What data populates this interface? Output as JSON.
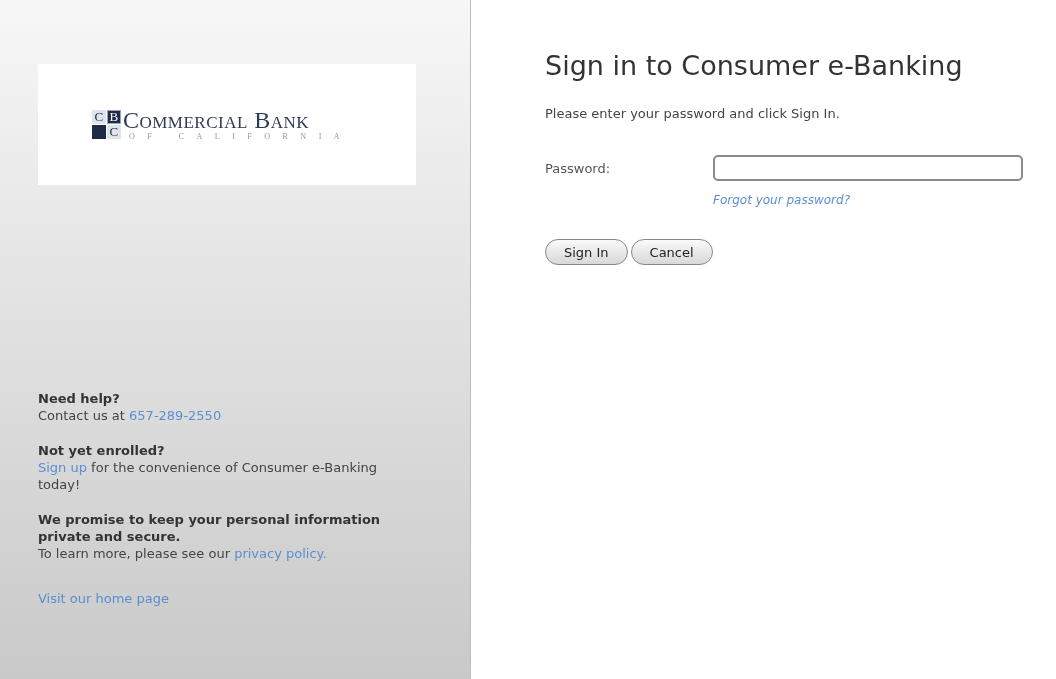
{
  "logo": {
    "monogram": [
      "C",
      "B",
      "C"
    ],
    "name": "Commercial Bank",
    "tagline": "OF CALIFORNIA"
  },
  "help_sections": [
    {
      "heading": "Need help?",
      "parts": [
        {
          "kind": "text",
          "text": "Contact us at "
        },
        {
          "kind": "link",
          "text": "657-289-2550"
        }
      ]
    },
    {
      "heading": "Not yet enrolled?",
      "parts": [
        {
          "kind": "link",
          "text": "Sign up"
        },
        {
          "kind": "text",
          "text": " for the convenience of Consumer e-Banking today!"
        }
      ]
    },
    {
      "heading": "We promise to keep your personal information private and secure.",
      "parts": [
        {
          "kind": "text",
          "text": "To learn more, please see our "
        },
        {
          "kind": "link",
          "text": "privacy policy."
        }
      ]
    }
  ],
  "home_link": "Visit our home page",
  "title": "Sign in to Consumer e-Banking",
  "instructions": "Please enter your password and click Sign In.",
  "password": {
    "label": "Password:",
    "forgot_link": "Forgot your password?"
  },
  "buttons": [
    "Sign In",
    "Cancel"
  ]
}
